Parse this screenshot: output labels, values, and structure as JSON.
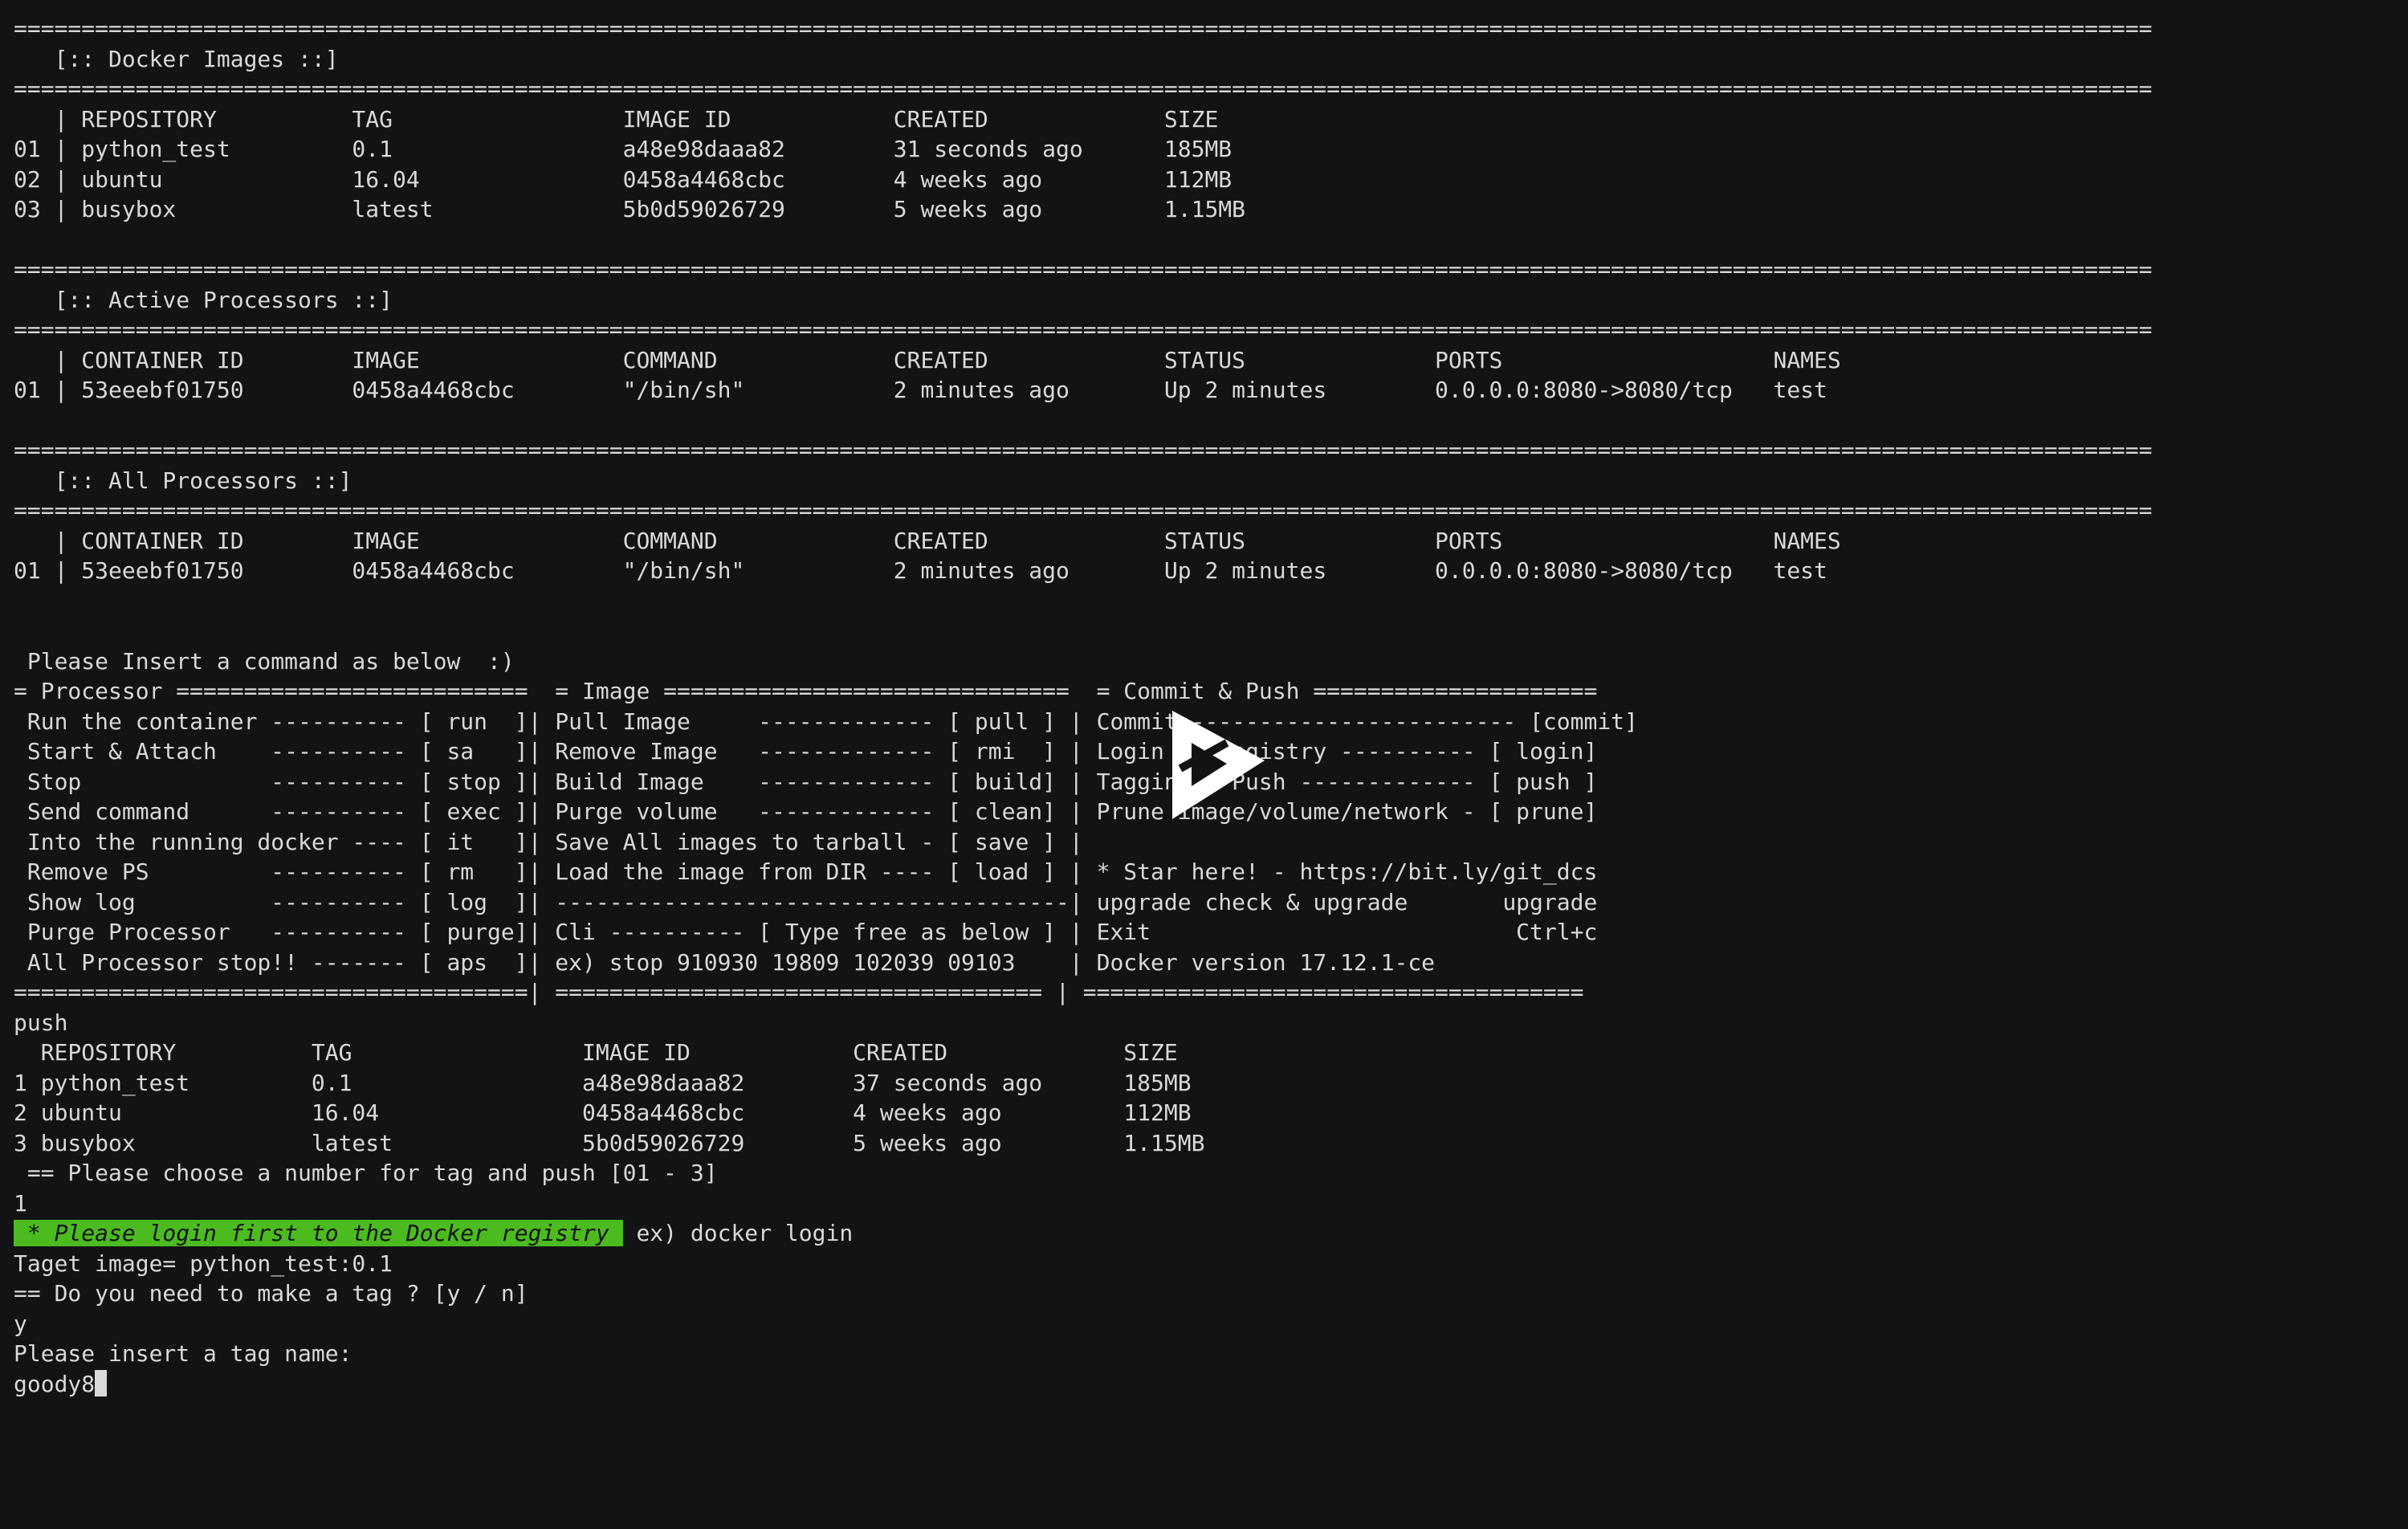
{
  "terminal": {
    "lines": [
      "==============================================================================================================================================================",
      "   [:: Docker Images ::]",
      "==============================================================================================================================================================",
      "   | REPOSITORY          TAG                 IMAGE ID            CREATED             SIZE",
      "01 | python_test         0.1                 a48e98daaa82        31 seconds ago      185MB",
      "02 | ubuntu              16.04               0458a4468cbc        4 weeks ago         112MB",
      "03 | busybox             latest              5b0d59026729        5 weeks ago         1.15MB",
      "",
      "==============================================================================================================================================================",
      "   [:: Active Processors ::]",
      "==============================================================================================================================================================",
      "   | CONTAINER ID        IMAGE               COMMAND             CREATED             STATUS              PORTS                    NAMES",
      "01 | 53eeebf01750        0458a4468cbc        \"/bin/sh\"           2 minutes ago       Up 2 minutes        0.0.0.0:8080->8080/tcp   test",
      "",
      "==============================================================================================================================================================",
      "   [:: All Processors ::]",
      "==============================================================================================================================================================",
      "   | CONTAINER ID        IMAGE               COMMAND             CREATED             STATUS              PORTS                    NAMES",
      "01 | 53eeebf01750        0458a4468cbc        \"/bin/sh\"           2 minutes ago       Up 2 minutes        0.0.0.0:8080->8080/tcp   test",
      "",
      "",
      " Please Insert a command as below  :)",
      "= Processor ==========================  = Image ==============================  = Commit & Push =====================",
      " Run the container ---------- [ run  ]| Pull Image     ------------- [ pull ] | Commit ------------------------ [commit]",
      " Start & Attach    ---------- [ sa   ]| Remove Image   ------------- [ rmi  ] | Login to registry ---------- [ login]",
      " Stop              ---------- [ stop ]| Build Image    ------------- [ build] | Tagging & Push ------------- [ push ]",
      " Send command      ---------- [ exec ]| Purge volume   ------------- [ clean] | Prune image/volume/network - [ prune]",
      " Into the running docker ---- [ it   ]| Save All images to tarball - [ save ] |",
      " Remove PS         ---------- [ rm   ]| Load the image from DIR ---- [ load ] | * Star here! - https://bit.ly/git_dcs",
      " Show log          ---------- [ log  ]| --------------------------------------| upgrade check & upgrade       upgrade",
      " Purge Processor   ---------- [ purge]| Cli ---------- [ Type free as below ] | Exit                           Ctrl+c",
      " All Processor stop!! ------- [ aps  ]| ex) stop 910930 19809 102039 09103    | Docker version 17.12.1-ce",
      "======================================| ==================================== | =====================================",
      "push",
      "  REPOSITORY          TAG                 IMAGE ID            CREATED             SIZE",
      "1 python_test         0.1                 a48e98daaa82        37 seconds ago      185MB",
      "2 ubuntu              16.04               0458a4468cbc        4 weeks ago         112MB",
      "3 busybox             latest              5b0d59026729        5 weeks ago         1.15MB",
      " == Please choose a number for tag and push [01 - 3]",
      "1"
    ],
    "login_notice": " * Please login first to the Docker registry ",
    "login_hint": " ex) docker login",
    "lines_after": [
      "Taget image= python_test:0.1",
      "== Do you need to make a tag ? [y / n]",
      "y",
      "Please insert a tag name:"
    ],
    "input_value": "goody8",
    "colors": {
      "background": "#121314",
      "foreground": "#d9d9d9",
      "highlight": "#4cbb1f"
    }
  },
  "overlay": {
    "icon": "play-icon"
  }
}
